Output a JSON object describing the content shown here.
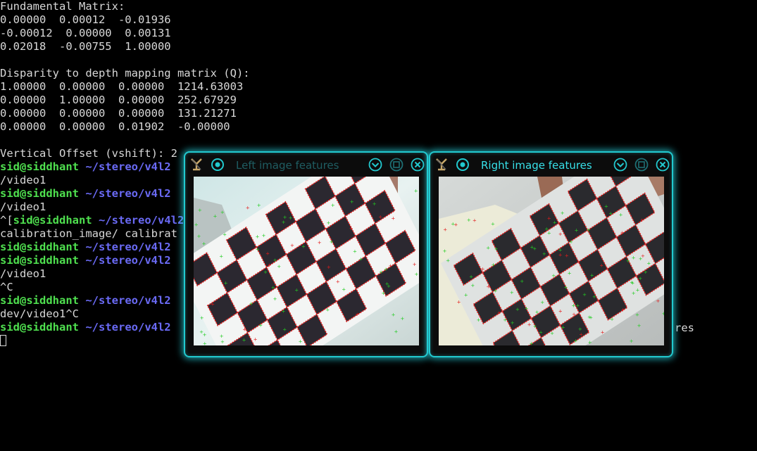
{
  "terminal": {
    "lines": [
      {
        "text": "Fundamental Matrix:"
      },
      {
        "text": "0.00000  0.00012  -0.01936"
      },
      {
        "text": "-0.00012  0.00000  0.00131"
      },
      {
        "text": "0.02018  -0.00755  1.00000"
      },
      {
        "text": ""
      },
      {
        "text": "Disparity to depth mapping matrix (Q):"
      },
      {
        "text": "1.00000  0.00000  0.00000  1214.63003"
      },
      {
        "text": "0.00000  1.00000  0.00000  252.67929"
      },
      {
        "text": "0.00000  0.00000  0.00000  131.21271"
      },
      {
        "text": "0.00000  0.00000  0.01902  -0.00000"
      },
      {
        "text": ""
      },
      {
        "text": "Vertical Offset (vshift): 2"
      },
      {
        "prefix": "",
        "user": "sid@siddhant",
        "path": "~/stereo/v4l2"
      },
      {
        "text": "/video1"
      },
      {
        "prefix": "",
        "user": "sid@siddhant",
        "path": "~/stereo/v4l2"
      },
      {
        "text": "/video1"
      },
      {
        "prefix": "^[",
        "user": "sid@siddhant",
        "path": "~/stereo/v4l2"
      },
      {
        "text": "calibration_image/ calibrat"
      },
      {
        "prefix": "",
        "user": "sid@siddhant",
        "path": "~/stereo/v4l2"
      },
      {
        "prefix": "",
        "user": "sid@siddhant",
        "path": "~/stereo/v4l2"
      },
      {
        "text": "/video1"
      },
      {
        "text": "^C"
      },
      {
        "prefix": "",
        "user": "sid@siddhant",
        "path": "~/stereo/v4l2"
      },
      {
        "text": "dev/video1^C"
      },
      {
        "prefix": "",
        "user": "sid@siddhant",
        "path": "~/stereo/v4l2"
      },
      {
        "cursor": true
      }
    ],
    "stray_text": "res"
  },
  "windows": [
    {
      "title": "Left image features",
      "active": false
    },
    {
      "title": "Right image features",
      "active": true
    }
  ],
  "colors": {
    "accent": "#22c9cf",
    "prompt_user": "#4fe04f",
    "prompt_path": "#6a6af5",
    "feature_edge": "#e31b1b",
    "feature_point": "#22cc22"
  }
}
